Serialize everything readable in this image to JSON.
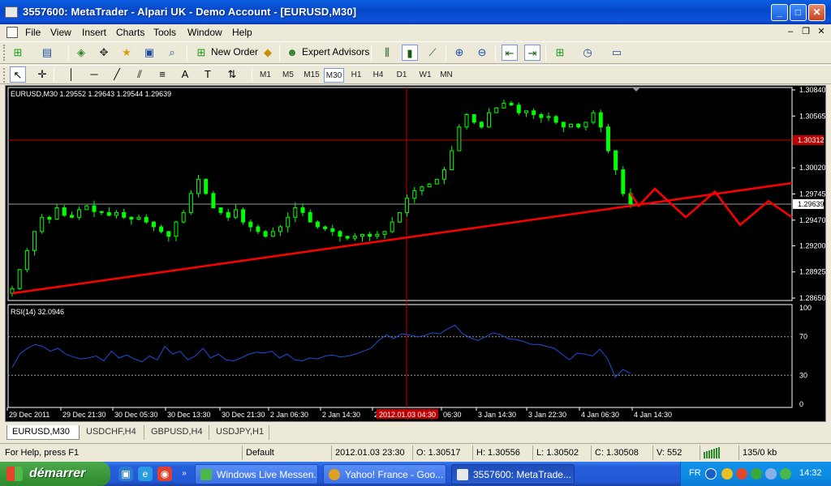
{
  "window": {
    "title": "3557600: MetaTrader - Alpari UK - Demo Account - [EURUSD,M30]",
    "buttons": {
      "minimize": "_",
      "maximize": "□",
      "close": "✕"
    }
  },
  "menu": [
    "File",
    "View",
    "Insert",
    "Charts",
    "Tools",
    "Window",
    "Help"
  ],
  "toolbar": {
    "new_order_label": "New Order",
    "expert_advisors_label": "Expert Advisors",
    "timeframes": [
      "M1",
      "M5",
      "M15",
      "M30",
      "H1",
      "H4",
      "D1",
      "W1",
      "MN"
    ],
    "selected_timeframe": "M30"
  },
  "chart": {
    "header": "EURUSD,M30  1.29552  1.29643  1.29544  1.29639",
    "price_ticks": [
      "1.30840",
      "1.30565",
      "1.30020",
      "1.29745",
      "1.29470",
      "1.29200",
      "1.28925",
      "1.28650"
    ],
    "current_price_label": "1.29639",
    "crosshair_price_label": "1.30312",
    "indicator_header": "RSI(14) 32.0946",
    "rsi_ticks": [
      "100",
      "70",
      "30",
      "0"
    ],
    "time_ticks": [
      "29 Dec 2011",
      "29 Dec 21:30",
      "30 Dec 05:30",
      "30 Dec 13:30",
      "30 Dec 21:30",
      "2 Jan 06:30",
      "2 Jan 14:30",
      "2",
      "06:30",
      "3 Jan 14:30",
      "3 Jan 22:30",
      "4 Jan 06:30",
      "4 Jan 14:30"
    ],
    "crosshair_time_label": "2012.01.03 04:30",
    "colors": {
      "candle": "#00ff00",
      "trendline": "#ff0000",
      "rsi": "#1e4fd8",
      "crosshair": "#c00000",
      "background": "#000000"
    }
  },
  "chart_data": {
    "type": "line",
    "title": "EURUSD,M30",
    "ylabel": "",
    "ylim": [
      1.2865,
      1.3084
    ],
    "rsi_ylim": [
      0,
      100
    ],
    "rsi_levels": [
      30,
      70
    ],
    "close_series": [
      1.2875,
      1.2895,
      1.2915,
      1.2935,
      1.295,
      1.2948,
      1.296,
      1.2952,
      1.295,
      1.2958,
      1.2962,
      1.2956,
      1.2955,
      1.2952,
      1.2955,
      1.295,
      1.2948,
      1.295,
      1.2945,
      1.294,
      1.2935,
      1.293,
      1.2945,
      1.2955,
      1.2975,
      1.299,
      1.2975,
      1.296,
      1.2955,
      1.295,
      1.2958,
      1.2945,
      1.294,
      1.2935,
      1.293,
      1.2935,
      1.294,
      1.295,
      1.296,
      1.2955,
      1.2945,
      1.294,
      1.2938,
      1.2935,
      1.293,
      1.2928,
      1.293,
      1.2932,
      1.293,
      1.2932,
      1.2935,
      1.2945,
      1.2955,
      1.297,
      1.2978,
      1.2982,
      1.2985,
      1.299,
      1.3,
      1.302,
      1.3045,
      1.3058,
      1.305,
      1.3045,
      1.306,
      1.3065,
      1.307,
      1.3068,
      1.306,
      1.3062,
      1.3058,
      1.3055,
      1.3056,
      1.305,
      1.3045,
      1.3048,
      1.3045,
      1.305,
      1.306,
      1.3045,
      1.302,
      1.3,
      1.2975,
      1.29639
    ],
    "trendline": {
      "from": {
        "time": "29 Dec 2011",
        "price": 1.287
      },
      "to": {
        "time": "4 Jan 14:30",
        "price": 1.2962
      }
    },
    "series": [
      {
        "name": "RSI(14)",
        "values": [
          38,
          52,
          58,
          62,
          60,
          55,
          58,
          52,
          49,
          47,
          48,
          50,
          45,
          55,
          48,
          51,
          47,
          44,
          50,
          46,
          60,
          52,
          55,
          46,
          50,
          58,
          48,
          52,
          46,
          45,
          48,
          52,
          54,
          53,
          55,
          48,
          52,
          46,
          45,
          48,
          47,
          50,
          51,
          49,
          50,
          52,
          55,
          58,
          66,
          72,
          68,
          73,
          72,
          70,
          71,
          74,
          73,
          78,
          82,
          73,
          69,
          66,
          70,
          74,
          72,
          68,
          67,
          65,
          62,
          62,
          60,
          58,
          52,
          46,
          53,
          52,
          50,
          57,
          47,
          28,
          36,
          32
        ]
      }
    ]
  },
  "tabs": [
    "EURUSD,M30",
    "USDCHF,H4",
    "GBPUSD,H4",
    "USDJPY,H1"
  ],
  "active_tab": "EURUSD,M30",
  "status": {
    "help": "For Help, press F1",
    "profile": "Default",
    "datetime": "2012.01.03 23:30",
    "open": "O: 1.30517",
    "high": "H: 1.30556",
    "low": "L: 1.30502",
    "close": "C: 1.30508",
    "volume": "V: 552",
    "traffic": "135/0 kb"
  },
  "taskbar": {
    "start_label": "démarrer",
    "tasks": [
      "Windows Live Messen...",
      "Yahoo! France - Goo...",
      "3557600: MetaTrade..."
    ],
    "language": "FR",
    "clock": "14:32"
  }
}
